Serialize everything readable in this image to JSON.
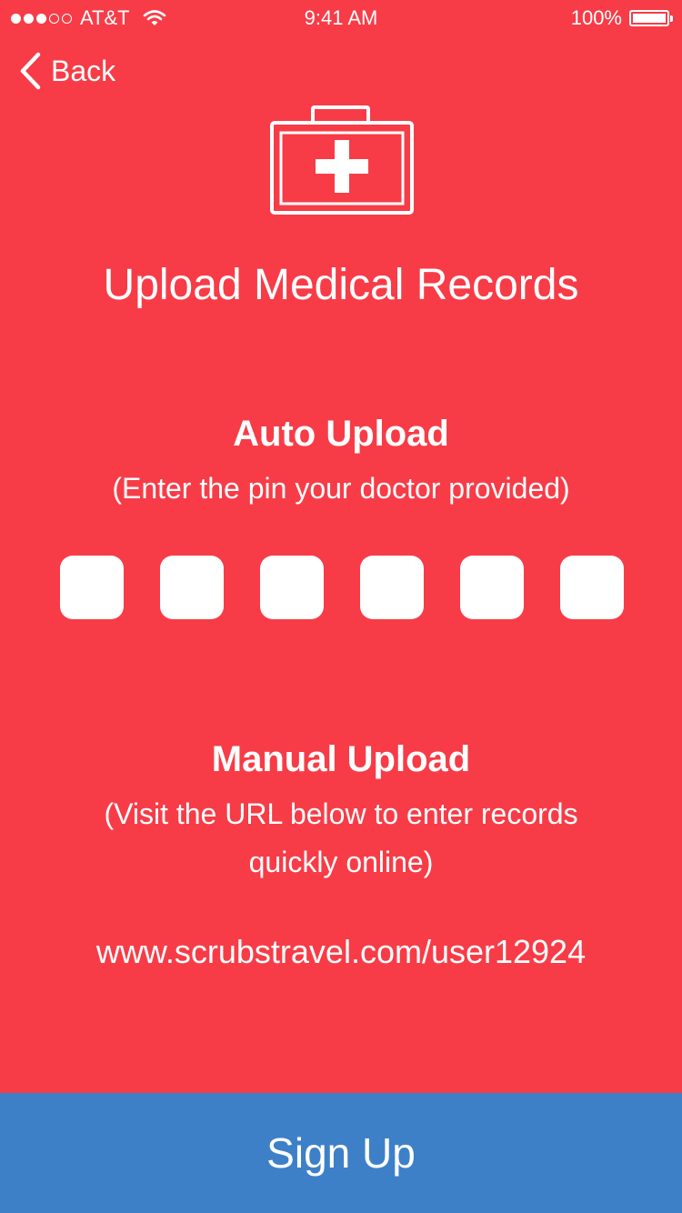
{
  "status_bar": {
    "carrier": "AT&T",
    "time": "9:41 AM",
    "battery": "100%",
    "signal_bars_filled": 3,
    "signal_bars_total": 5
  },
  "nav": {
    "back_label": "Back"
  },
  "header": {
    "icon": "first-aid-kit-icon",
    "title": "Upload Medical Records"
  },
  "auto_upload": {
    "title": "Auto Upload",
    "subtitle": "(Enter the pin your doctor provided)",
    "pin": [
      "",
      "",
      "",
      "",
      "",
      ""
    ]
  },
  "manual_upload": {
    "title": "Manual Upload",
    "subtitle": "(Visit the URL below to enter records quickly online)",
    "url": "www.scrubstravel.com/user12924"
  },
  "footer": {
    "signup_label": "Sign Up"
  },
  "colors": {
    "background": "#f73c47",
    "button": "#3d80c8",
    "text": "#ffffff"
  }
}
